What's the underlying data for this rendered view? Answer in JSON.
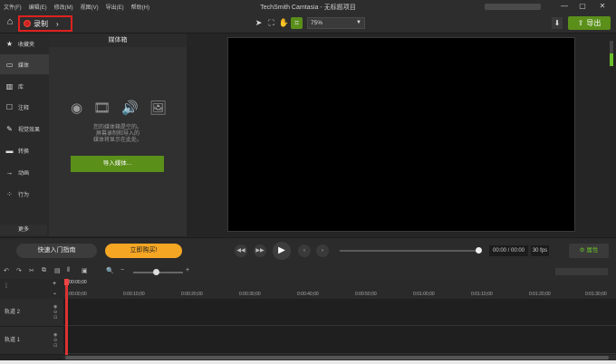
{
  "window": {
    "title": "TechSmith Camtasia - 无标题项目",
    "menu": [
      "文件(F)",
      "编辑(E)",
      "修改(M)",
      "视图(V)",
      "导出(E)",
      "帮助(H)"
    ],
    "controls": {
      "minimize": "—",
      "maximize": "▢",
      "close": "✕"
    }
  },
  "toolbar": {
    "record_label": "录制",
    "zoom_value": "75%",
    "export_label": "导出"
  },
  "sidebar": {
    "items": [
      {
        "label": "收藏夹",
        "icon": "star-icon"
      },
      {
        "label": "媒体",
        "icon": "media-icon"
      },
      {
        "label": "库",
        "icon": "library-icon"
      },
      {
        "label": "注释",
        "icon": "annotation-icon"
      },
      {
        "label": "视觉效果",
        "icon": "visual-effects-icon"
      },
      {
        "label": "转换",
        "icon": "transition-icon"
      },
      {
        "label": "动画",
        "icon": "animation-icon"
      },
      {
        "label": "行为",
        "icon": "behavior-icon"
      }
    ],
    "more_label": "更多",
    "add_label": "+"
  },
  "media_bin": {
    "title": "媒体箱",
    "empty_line1": "您的媒体箱是空的。",
    "empty_line2": "屏幕录制和导入的",
    "empty_line3": "媒体将显示在此处。",
    "import_label": "导入媒体..."
  },
  "playback": {
    "guide_label": "快速入门指南",
    "buy_label": "立即购买!",
    "time": "00:00 / 00:00",
    "fps": "30 fps",
    "properties_label": "属性"
  },
  "timeline": {
    "playhead_time": "0:00:00;00",
    "ticks": [
      "0:00:00;00",
      "0:00:10;00",
      "0:00:20;00",
      "0:00:30;00",
      "0:00:40;00",
      "0:00:50;00",
      "0:01:00;00",
      "0:01:10;00",
      "0:01:20;00",
      "0:01:30;00"
    ],
    "tracks": [
      "轨道 2",
      "轨道 1"
    ]
  },
  "colors": {
    "accent": "#5a8f1a",
    "buy": "#f5a623",
    "record_highlight": "#e02020"
  }
}
